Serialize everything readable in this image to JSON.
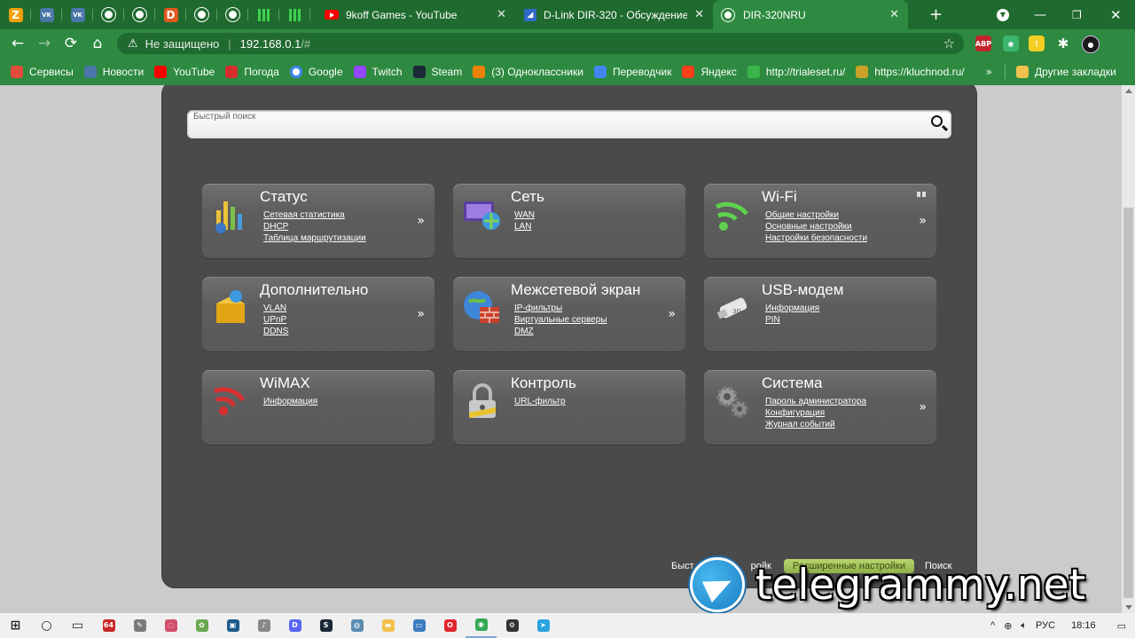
{
  "tabs": {
    "pinned": [
      {
        "name": "zoom-icon",
        "letter": "Z",
        "color": "#f2a00c"
      },
      {
        "name": "vk-icon",
        "letter": "VK",
        "color": "#4a76a8"
      },
      {
        "name": "vk-icon",
        "letter": "VK",
        "color": "#4a76a8"
      },
      {
        "name": "globe-icon"
      },
      {
        "name": "globe-icon"
      },
      {
        "name": "dota-icon",
        "letter": "D",
        "color": "#e2581d"
      },
      {
        "name": "globe-icon"
      },
      {
        "name": "globe-icon"
      },
      {
        "name": "grid-icon"
      },
      {
        "name": "grid-icon"
      }
    ],
    "open": [
      {
        "title": "9koff Games - YouTube",
        "icon": "youtube-icon"
      },
      {
        "title": "D-Link DIR-320 - Обсуждение -",
        "icon": "dlink-icon"
      },
      {
        "title": "DIR-320NRU",
        "icon": "globe-icon",
        "active": true
      }
    ],
    "new_tab": "+"
  },
  "toolbar": {
    "back": "←",
    "forward": "→",
    "reload": "C",
    "home": "⌂",
    "security_label": "Не защищено",
    "url_host": "192.168.0.1",
    "url_path": "/#",
    "bookmark_star": "☆"
  },
  "extensions": [
    {
      "name": "adblock-icon",
      "label": "ABP",
      "color": "#c3252b"
    },
    {
      "name": "location-icon",
      "label": "◉",
      "color": "#3bb56e"
    },
    {
      "name": "idea-icon",
      "label": "!",
      "color": "#f5ce24"
    },
    {
      "name": "puzzle-icon",
      "label": "✱",
      "color": "transparent"
    },
    {
      "name": "profile-avatar",
      "label": "●",
      "color": "#1a1a1a"
    }
  ],
  "bookmarks": [
    {
      "label": "Сервисы",
      "icon": "apps-icon",
      "color": "#e34b3b"
    },
    {
      "label": "Новости",
      "icon": "vk-icon",
      "color": "#4a76a8"
    },
    {
      "label": "YouTube",
      "icon": "youtube-icon",
      "color": "#ff0000"
    },
    {
      "label": "Погода",
      "icon": "weather-icon",
      "color": "#d62d2d"
    },
    {
      "label": "Google",
      "icon": "google-icon",
      "color": "#ffffff"
    },
    {
      "label": "Twitch",
      "icon": "twitch-icon",
      "color": "#9146ff"
    },
    {
      "label": "Steam",
      "icon": "steam-icon",
      "color": "#1b2838"
    },
    {
      "label": "(3) Одноклассники",
      "icon": "ok-icon",
      "color": "#ee8208"
    },
    {
      "label": "Переводчик",
      "icon": "translate-icon",
      "color": "#4285f4"
    },
    {
      "label": "Яндекс",
      "icon": "yandex-icon",
      "color": "#fc3f1d"
    },
    {
      "label": "http://trialeset.ru/",
      "icon": "link-icon",
      "color": "#3bb54a"
    },
    {
      "label": "https://kluchnod.ru/",
      "icon": "key-icon",
      "color": "#c9a227"
    }
  ],
  "bookmarks_more": "»",
  "other_bookmarks": "Другие закладки",
  "router": {
    "search_placeholder": "Быстрый поиск",
    "cards": [
      {
        "title": "Статус",
        "icon": "status-icon",
        "links": [
          "Сетевая статистика",
          "DHCP",
          "Таблица маршрутизации"
        ],
        "more": "»"
      },
      {
        "title": "Сеть",
        "icon": "network-icon",
        "links": [
          "WAN",
          "LAN"
        ]
      },
      {
        "title": "Wi-Fi",
        "icon": "wifi-icon",
        "links": [
          "Общие настройки",
          "Основные настройки",
          "Настройки безопасности"
        ],
        "more": "»",
        "pager": true
      },
      {
        "title": "Дополнительно",
        "icon": "advanced-icon",
        "links": [
          "VLAN",
          "UPnP",
          "DDNS"
        ],
        "more": "»"
      },
      {
        "title": "Межсетевой экран",
        "icon": "firewall-icon",
        "links": [
          "IP-фильтры",
          "Виртуальные серверы",
          "DMZ"
        ],
        "more": "»"
      },
      {
        "title": "USB-модем",
        "icon": "usb-modem-icon",
        "links": [
          "Информация",
          "PIN"
        ]
      },
      {
        "title": "WiMAX",
        "icon": "wimax-icon",
        "links": [
          "Информация"
        ]
      },
      {
        "title": "Контроль",
        "icon": "lock-icon",
        "links": [
          "URL-фильтр"
        ]
      },
      {
        "title": "Система",
        "icon": "gears-icon",
        "links": [
          "Пароль администратора",
          "Конфигурация",
          "Журнал событий"
        ],
        "more": "»"
      }
    ],
    "bottom": {
      "quick": "Быст",
      "quick_tail": "ройк",
      "advanced": "Расширенные настройки",
      "search": "Поиск"
    }
  },
  "watermark": "telegrammy.net",
  "taskbar": {
    "apps": [
      {
        "name": "windows-start-icon",
        "label": "⊞",
        "color": "#222"
      },
      {
        "name": "search-icon",
        "label": "○",
        "color": "#222"
      },
      {
        "name": "task-view-icon",
        "label": "▭",
        "color": "#222"
      },
      {
        "name": "64-icon",
        "label": "64",
        "color": "#c62828"
      },
      {
        "name": "app-icon",
        "label": "✎",
        "color": "#7a7a7a"
      },
      {
        "name": "app-icon",
        "label": "◌",
        "color": "#d14f6b"
      },
      {
        "name": "app-icon",
        "label": "✿",
        "color": "#6aa84f"
      },
      {
        "name": "app-icon",
        "label": "▣",
        "color": "#1e5a8a"
      },
      {
        "name": "speaker-icon",
        "label": "♪",
        "color": "#888"
      },
      {
        "name": "discord-icon",
        "label": "D",
        "color": "#5865f2"
      },
      {
        "name": "steam-icon",
        "label": "S",
        "color": "#1b2838"
      },
      {
        "name": "app-icon",
        "label": "◍",
        "color": "#5b8bb0"
      },
      {
        "name": "folder-icon",
        "label": "▬",
        "color": "#f2c14e"
      },
      {
        "name": "monitor-icon",
        "label": "▭",
        "color": "#3b7bbf"
      },
      {
        "name": "opera-icon",
        "label": "O",
        "color": "#e2262d"
      },
      {
        "name": "chrome-icon",
        "label": "◉",
        "color": "#34a853",
        "active": true
      },
      {
        "name": "settings-icon",
        "label": "⚙",
        "color": "#333"
      },
      {
        "name": "telegram-icon",
        "label": "➤",
        "color": "#2aa3df"
      }
    ],
    "lang": "РУС",
    "time": "18:16"
  }
}
